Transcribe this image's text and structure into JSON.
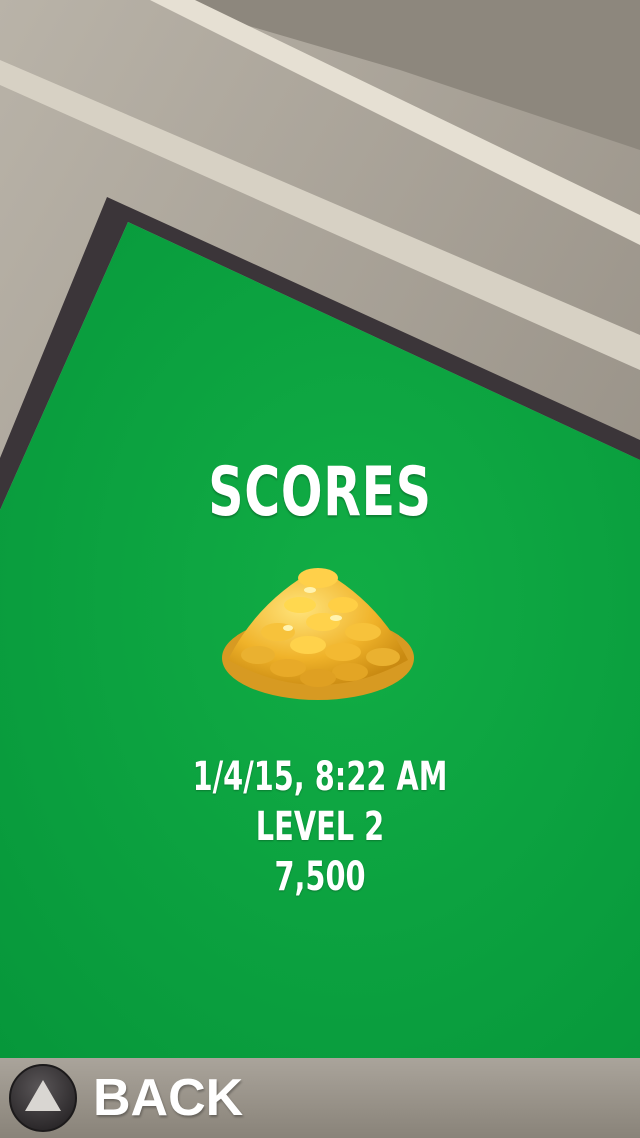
{
  "screen": {
    "title": "SCORES"
  },
  "score_entry": {
    "date": "1/4/15, 8:22 AM",
    "level": "LEVEL 2",
    "score": "7,500"
  },
  "bottom_bar": {
    "back_label": "BACK"
  },
  "icons": {
    "coins": "gold-coin-pile-icon",
    "back": "up-triangle-icon"
  },
  "colors": {
    "felt_green": "#0a9a3a",
    "table_rail": "#cfc9bd",
    "table_edge": "#3b3539",
    "text": "#ffffff"
  }
}
